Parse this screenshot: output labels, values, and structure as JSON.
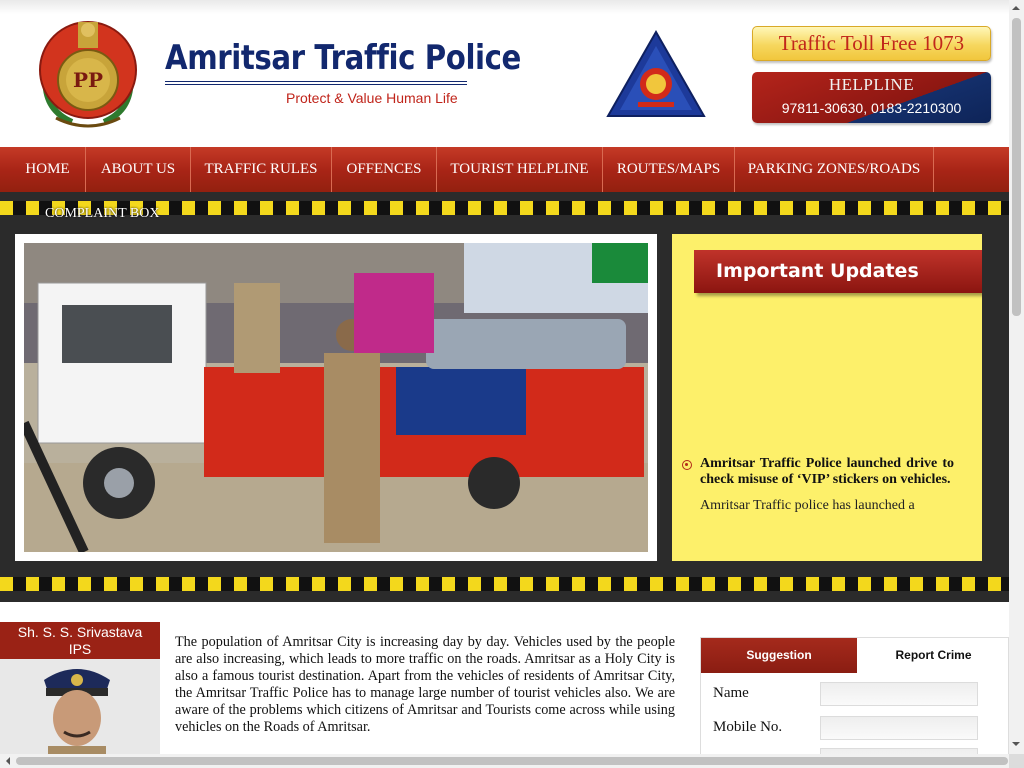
{
  "header": {
    "title": "Amritsar Traffic Police",
    "tagline": "Protect & Value Human Life",
    "toll_free": "Traffic Toll Free 1073",
    "helpline_title": "HELPLINE",
    "helpline_numbers": "97811-30630, 0183-2210300"
  },
  "nav": {
    "items": [
      "HOME",
      "ABOUT US",
      "TRAFFIC RULES",
      "OFFENCES",
      "TOURIST HELPLINE",
      "ROUTES/MAPS",
      "PARKING ZONES/ROADS"
    ],
    "overflow_item": "COMPLAINT BOX"
  },
  "updates": {
    "heading": "Important Updates",
    "items": [
      {
        "title": "Amritsar Traffic Police launched drive to check misuse of ‘VIP’ stickers on vehicles.",
        "text": "Amritsar Traffic police has launched a"
      }
    ]
  },
  "officer": {
    "name": "Sh. S. S. Srivastava",
    "rank": "IPS"
  },
  "intro": {
    "text": "The population of Amritsar City is increasing day by day. Vehicles used by the people are also increasing, which leads to more traffic on the roads. Amritsar as a Holy City is also a famous tourist destination. Apart from the vehicles of residents of Amritsar City, the Amritsar Traffic Police has to manage large number of tourist vehicles also. We are aware of the problems which citizens of Amritsar and Tourists come across while using vehicles on the Roads of Amritsar."
  },
  "form": {
    "tabs": [
      "Suggestion",
      "Report Crime"
    ],
    "active_tab": "Suggestion",
    "fields": [
      {
        "label": "Name",
        "value": ""
      },
      {
        "label": "Mobile No.",
        "value": ""
      }
    ]
  },
  "colors": {
    "brand_blue": "#12286e",
    "brand_red": "#a92517",
    "stripe_yellow": "#f3d81c",
    "updates_yellow": "#fdf06a"
  }
}
